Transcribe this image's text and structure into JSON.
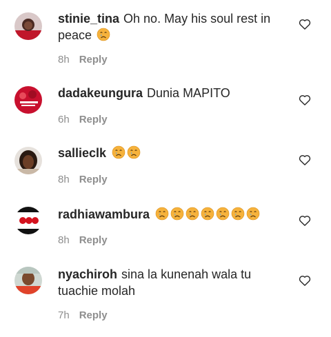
{
  "reply_label": "Reply",
  "emoji_name": "crying-face-emoji",
  "heart_icon": "heart-outline-icon",
  "colors": {
    "text": "#262626",
    "meta": "#8e8e8e",
    "emoji_face": "#f6b23c",
    "emoji_tear": "#5aa7e8"
  },
  "comments": [
    {
      "username": "stinie_tina",
      "text": "Oh no. May his soul rest in",
      "text2": "peace",
      "emoji_count": 1,
      "time": "8h"
    },
    {
      "username": "dadakeungura",
      "text": "Dunia MAPITO",
      "emoji_count": 0,
      "time": "6h"
    },
    {
      "username": "sallieclk",
      "text": "",
      "emoji_count": 2,
      "time": "8h"
    },
    {
      "username": "radhiawambura",
      "text": "",
      "emoji_count": 7,
      "time": "8h"
    },
    {
      "username": "nyachiroh",
      "text": "sina la kunenah wala tu",
      "text2": "tuachie molah",
      "emoji_count": 0,
      "time": "7h"
    }
  ]
}
